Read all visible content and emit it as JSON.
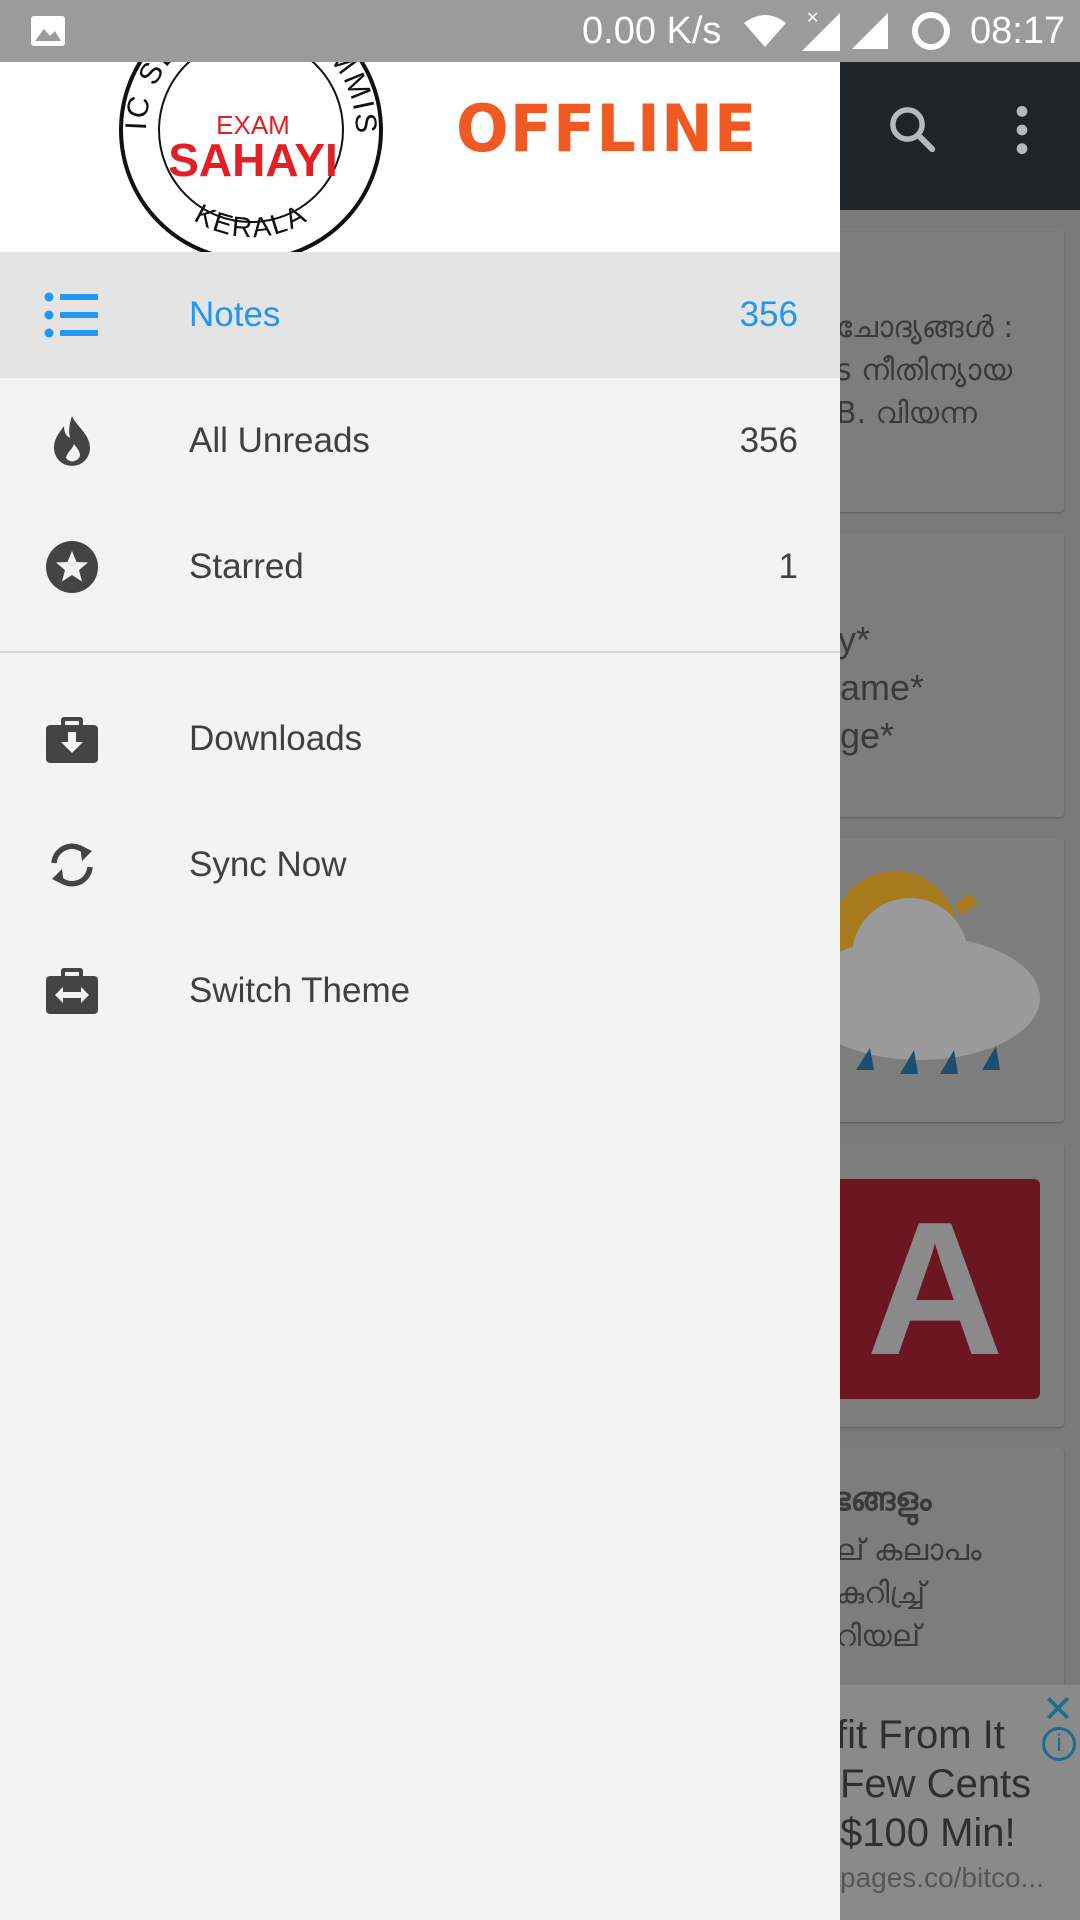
{
  "status_bar": {
    "network_speed": "0.00 K/s",
    "time": "08:17"
  },
  "drawer": {
    "logo": {
      "ring_text_top": "PUBLIC SERVICE COMMISSION",
      "ring_text_bottom": "KERALA",
      "exam": "EXAM",
      "sahayi": "SAHAYI"
    },
    "header_badge": "OFFLINE",
    "items": [
      {
        "label": "Notes",
        "count": "356",
        "icon": "list-icon",
        "active": true
      },
      {
        "label": "All Unreads",
        "count": "356",
        "icon": "flame-icon"
      },
      {
        "label": "Starred",
        "count": "1",
        "icon": "star-circle-icon"
      },
      {
        "label": "Downloads",
        "icon": "download-briefcase-icon"
      },
      {
        "label": "Sync Now",
        "icon": "sync-icon"
      },
      {
        "label": "Switch Theme",
        "icon": "switch-theme-icon"
      }
    ]
  },
  "background": {
    "cards": [
      {
        "lines": [
          "ചോദ്യങ്ങൾ :",
          "s നീതിന്യായ",
          "B. വിയന്ന"
        ]
      },
      {
        "lines": [
          "y*",
          "ame*",
          "ge*"
        ]
      },
      {
        "lines": [
          "ഭങ്ങളും",
          "ല് കലാപം",
          "കുറിച്ച്ര്",
          "റിയല്"
        ]
      }
    ],
    "tile_letter": "A",
    "ad": {
      "lines": [
        "fit From It",
        "Few Cents",
        "$100 Min!"
      ],
      "url": "pages.co/bitco..."
    }
  },
  "colors": {
    "accent": "#2196f3",
    "offline_orange": "#f05a22",
    "logo_red": "#e31e24"
  }
}
